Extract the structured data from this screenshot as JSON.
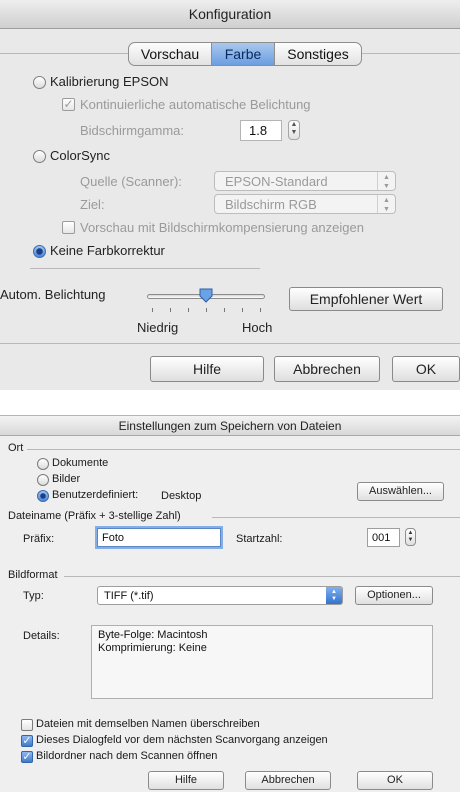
{
  "dialog1": {
    "title": "Konfiguration",
    "tabs": [
      {
        "label": "Vorschau",
        "active": false
      },
      {
        "label": "Farbe",
        "active": true
      },
      {
        "label": "Sonstiges",
        "active": false
      }
    ],
    "kalibrierung_label": "Kalibrierung EPSON",
    "kontinuierlich_label": "Kontinuierliche automatische Belichtung",
    "kontinuierlich_mark": "✓",
    "gamma_label": "Bidschirmgamma:",
    "gamma_value": "1.8",
    "colorsync_label": "ColorSync",
    "quelle_label": "Quelle (Scanner):",
    "quelle_value": "EPSON-Standard",
    "ziel_label": "Ziel:",
    "ziel_value": "Bildschirm RGB",
    "vorschau_label": "Vorschau mit Bildschirmkompensierung anzeigen",
    "keine_label": "Keine Farbkorrektur",
    "selected_radio": "keine_farbkorrektur",
    "belichtung_label": "Autom. Belichtung",
    "slider_level": 0.5,
    "niedrig_label": "Niedrig",
    "hoch_label": "Hoch",
    "empfohlen_label": "Empfohlener Wert",
    "hilfe_label": "Hilfe",
    "abbrechen_label": "Abbrechen",
    "ok_label": "OK"
  },
  "dialog2": {
    "title": "Einstellungen zum Speichern von Dateien",
    "ort_label": "Ort",
    "dokumente_label": "Dokumente",
    "bilder_label": "Bilder",
    "benutzer_label": "Benutzerdefiniert:",
    "benutzer_value": "Desktop",
    "selected_location": "benutzerdefiniert",
    "auswaehlen_label": "Auswählen...",
    "dateiname_label": "Dateiname (Präfix + 3-stellige Zahl)",
    "praefix_label": "Präfix:",
    "praefix_value": "Foto",
    "startzahl_label": "Startzahl:",
    "startzahl_value": "001",
    "bildformat_label": "Bildformat",
    "typ_label": "Typ:",
    "typ_value": "TIFF (*.tif)",
    "optionen_label": "Optionen...",
    "details_label": "Details:",
    "details_line1": "Byte-Folge: Macintosh",
    "details_line2": "Komprimierung: Keine",
    "check_overwrite_label": "Dateien mit demselben Namen überschreiben",
    "check_overwrite": false,
    "check_dialog_label": "Dieses Dialogfeld vor dem nächsten Scanvorgang anzeigen",
    "check_dialog": true,
    "check_open_label": "Bildordner nach dem Scannen öffnen",
    "check_open": true,
    "check_mark": "✓",
    "hilfe_label": "Hilfe",
    "abbrechen_label": "Abbrechen",
    "ok_label": "OK"
  },
  "colors": {
    "accent": "#4d86d6",
    "disabled_text": "#9a9a9a"
  }
}
